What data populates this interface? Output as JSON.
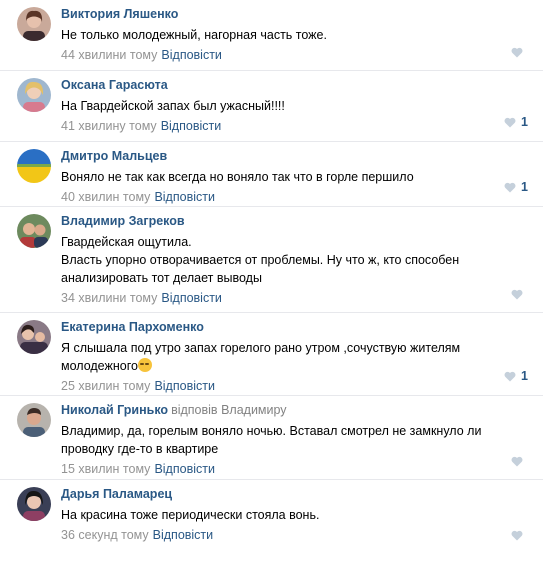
{
  "colors": {
    "author": "#2a5885",
    "meta": "#939393",
    "divider": "#e7e8ec",
    "like_inactive": "#c5d0db"
  },
  "comments": [
    {
      "author": "Виктория Ляшенко",
      "text": "Не только молодежный, нагорная часть тоже.",
      "time": "44 хвилини тому",
      "reply_label": "Відповісти",
      "likes": ""
    },
    {
      "author": "Оксана Гарасюта",
      "text": "На Гвардейской запах был ужасный!!!!",
      "time": "41 хвилину тому",
      "reply_label": "Відповісти",
      "likes": "1"
    },
    {
      "author": "Дмитро Мальцев",
      "text": "Воняло не так как всегда но воняло так что в горле першило",
      "time": "40 хвилин тому",
      "reply_label": "Відповісти",
      "likes": "1"
    },
    {
      "author": "Владимир Загреков",
      "text": "Гвардейская ощутила.\nВласть упорно отворачивается от проблемы. Ну что ж, кто способен анализировать тот делает выводы",
      "time": "34 хвилини тому",
      "reply_label": "Відповісти",
      "likes": ""
    },
    {
      "author": "Екатерина Пархоменко",
      "text": "Я слышала под утро запах горелого рано утром ,сочуствую жителям молодежного",
      "emoji": "sad-face-emoji",
      "time": "25 хвилин тому",
      "reply_label": "Відповісти",
      "likes": "1"
    },
    {
      "author": "Николай Гринько",
      "reply_prefix": "відповів",
      "reply_to": "Владимиру",
      "text": "Владимир, да, горелым воняло ночью. Вставал смотрел не замкнуло ли проводку где-то в квартире",
      "time": "15 хвилин тому",
      "reply_label": "Відповісти",
      "likes": ""
    },
    {
      "author": "Дарья Паламарец",
      "text": "На красина тоже периодически стояла вонь.",
      "time": "36 секунд тому",
      "reply_label": "Відповісти",
      "likes": ""
    }
  ]
}
